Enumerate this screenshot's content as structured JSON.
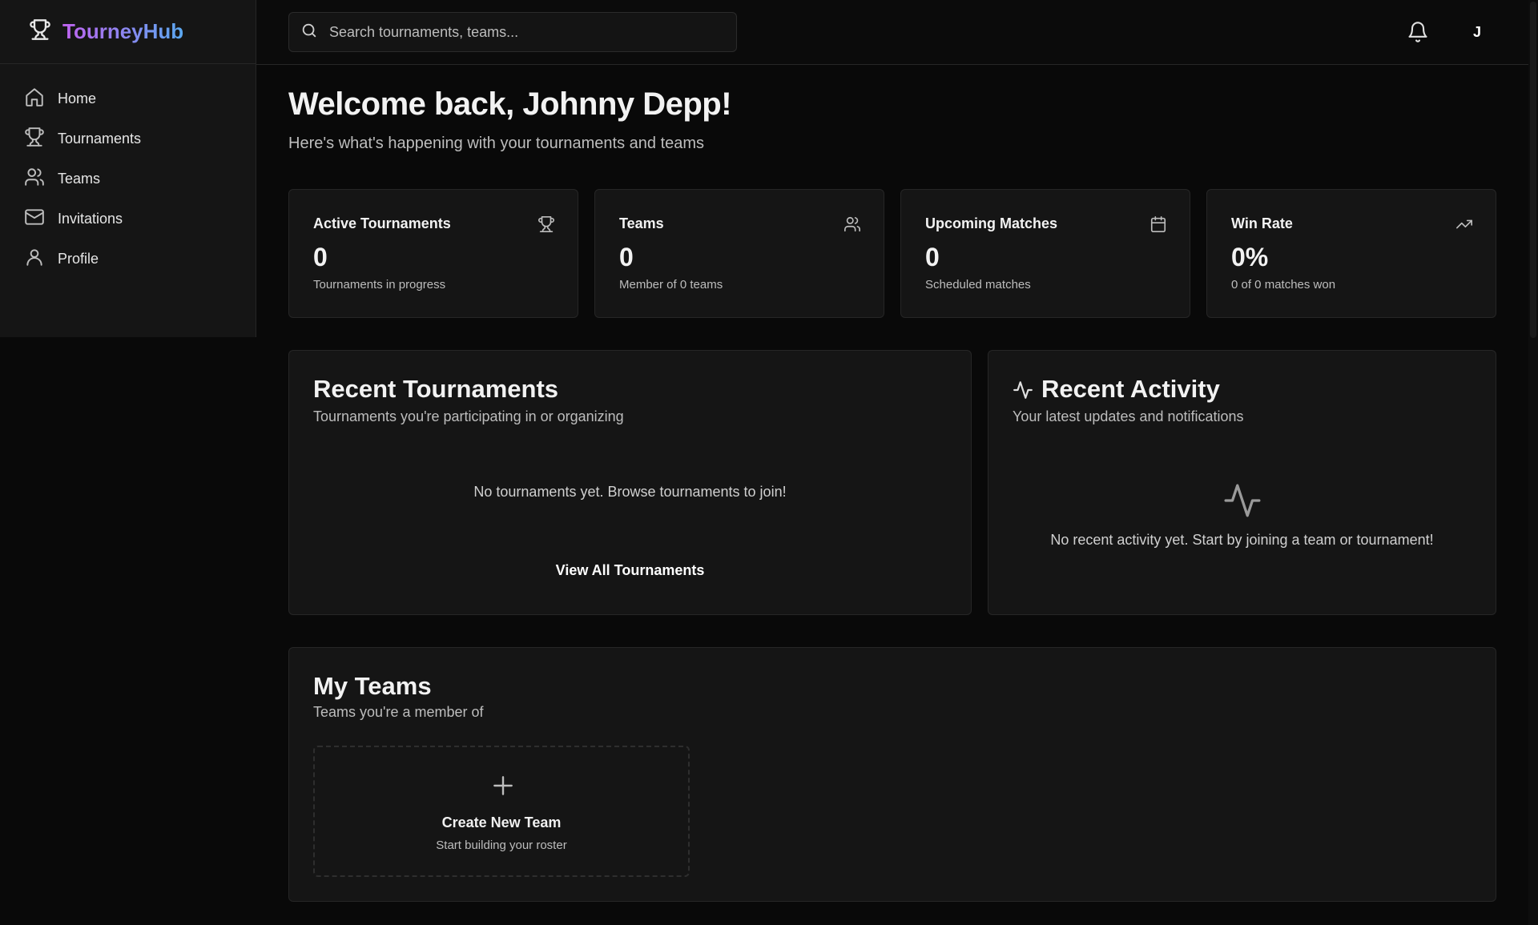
{
  "brand": {
    "name": "TourneyHub",
    "icon": "trophy-icon"
  },
  "sidebar": {
    "items": [
      {
        "label": "Home",
        "icon": "home-icon"
      },
      {
        "label": "Tournaments",
        "icon": "trophy-icon"
      },
      {
        "label": "Teams",
        "icon": "users-icon"
      },
      {
        "label": "Invitations",
        "icon": "mail-icon"
      },
      {
        "label": "Profile",
        "icon": "user-icon"
      }
    ]
  },
  "header": {
    "search_placeholder": "Search tournaments, teams...",
    "avatar_initial": "J"
  },
  "welcome": {
    "title": "Welcome back, Johnny Depp!",
    "subtitle": "Here's what's happening with your tournaments and teams"
  },
  "stats": [
    {
      "title": "Active Tournaments",
      "value": "0",
      "desc": "Tournaments in progress",
      "icon": "trophy-icon"
    },
    {
      "title": "Teams",
      "value": "0",
      "desc": "Member of 0 teams",
      "icon": "users-icon"
    },
    {
      "title": "Upcoming Matches",
      "value": "0",
      "desc": "Scheduled matches",
      "icon": "calendar-icon"
    },
    {
      "title": "Win Rate",
      "value": "0%",
      "desc": "0 of 0 matches won",
      "icon": "trending-up-icon"
    }
  ],
  "recent_tournaments": {
    "title": "Recent Tournaments",
    "subtitle": "Tournaments you're participating in or organizing",
    "empty": "No tournaments yet. Browse tournaments to join!",
    "button": "View All Tournaments"
  },
  "recent_activity": {
    "title": "Recent Activity",
    "subtitle": "Your latest updates and notifications",
    "empty": "No recent activity yet. Start by joining a team or tournament!"
  },
  "my_teams": {
    "title": "My Teams",
    "subtitle": "Teams you're a member of",
    "create_title": "Create New Team",
    "create_sub": "Start building your roster"
  },
  "colors": {
    "background": "#090909",
    "card": "#151515",
    "border": "#262626",
    "brand_from": "#c063f0",
    "brand_to": "#5aa8f0"
  }
}
